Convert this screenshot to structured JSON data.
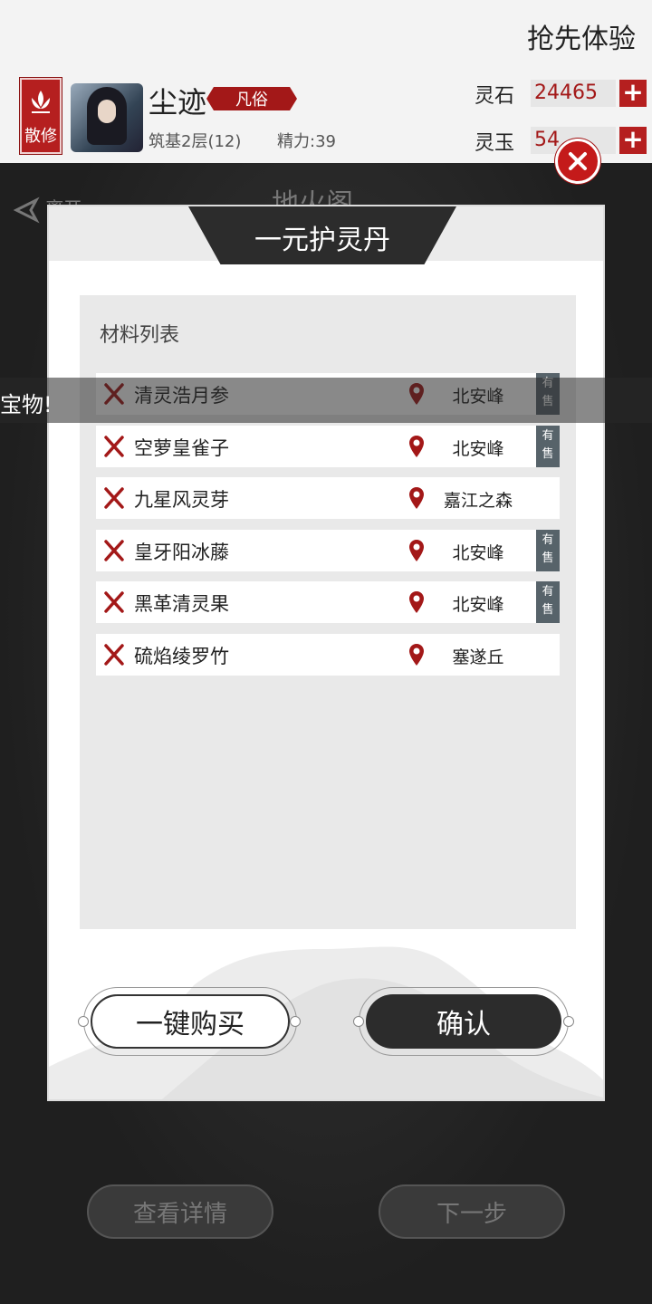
{
  "topbar": {
    "action_label": "抢先体验"
  },
  "player": {
    "class_badge": "散修",
    "name": "尘迹",
    "rank": "凡俗",
    "realm": "筑基2层(12)",
    "energy": "精力:39"
  },
  "resources": [
    {
      "label": "灵石",
      "value": "24465"
    },
    {
      "label": "灵玉",
      "value": "54"
    }
  ],
  "behind": {
    "back_label": "离开",
    "title": "地火阁"
  },
  "modal": {
    "title": "一元护灵丹",
    "panel_title": "材料列表",
    "materials": [
      {
        "name": "清灵浩月参",
        "location": "北安峰",
        "on_sale": "有售",
        "has_sale": true
      },
      {
        "name": "空萝皇雀子",
        "location": "北安峰",
        "on_sale": "有售",
        "has_sale": true
      },
      {
        "name": "九星风灵芽",
        "location": "嘉江之森",
        "on_sale": "",
        "has_sale": false
      },
      {
        "name": "皇牙阳冰藤",
        "location": "北安峰",
        "on_sale": "有售",
        "has_sale": true
      },
      {
        "name": "黑革清灵果",
        "location": "北安峰",
        "on_sale": "有售",
        "has_sale": true
      },
      {
        "name": "硫焰绫罗竹",
        "location": "塞遂丘",
        "on_sale": "",
        "has_sale": false
      }
    ],
    "buy_all_label": "一键购买",
    "confirm_label": "确认"
  },
  "toast": {
    "text": "宝物!"
  },
  "bottom": {
    "details_label": "查看详情",
    "next_label": "下一步"
  },
  "colors": {
    "accent_red": "#b51f1f",
    "dark": "#2c2c2c",
    "sale_badge": "#57636a"
  }
}
